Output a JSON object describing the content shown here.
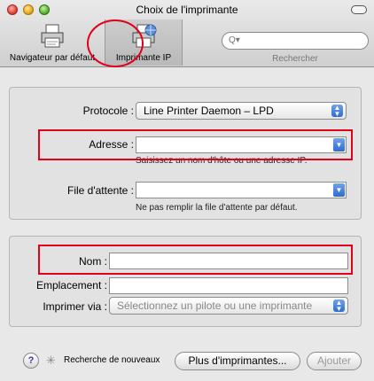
{
  "window": {
    "title": "Choix de l'imprimante"
  },
  "toolbar": {
    "default_browser_label": "Navigateur par défaut",
    "ip_printer_label": "Imprimante IP",
    "search_placeholder": "Q▾",
    "search_label": "Rechercher"
  },
  "ip_form": {
    "protocol_label": "Protocole :",
    "protocol_value": "Line Printer Daemon – LPD",
    "address_label": "Adresse :",
    "address_value": "",
    "address_hint": "Saisissez un nom d'hôte ou une adresse IP.",
    "queue_label": "File d'attente :",
    "queue_value": "",
    "queue_hint": "Ne pas remplir la file d'attente par défaut."
  },
  "printer_info": {
    "name_label": "Nom :",
    "name_value": "",
    "location_label": "Emplacement :",
    "location_value": "",
    "print_using_label": "Imprimer via :",
    "print_using_value": "Sélectionnez un pilote ou une imprimante"
  },
  "footer": {
    "help_label": "?",
    "status_text": "Recherche de nouveaux",
    "more_printers_label": "Plus d'imprimantes...",
    "add_label": "Ajouter"
  }
}
